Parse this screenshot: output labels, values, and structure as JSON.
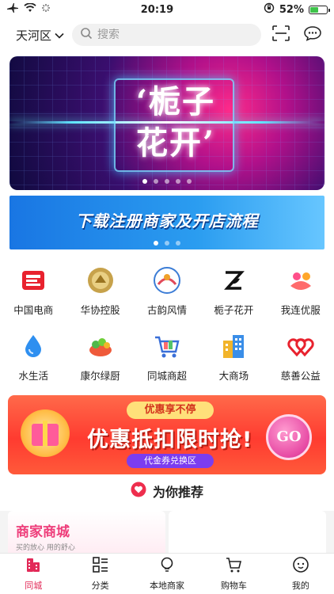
{
  "status_bar": {
    "time": "20:19",
    "battery": "52%",
    "battery_level": 0.52
  },
  "header": {
    "city": "天河区",
    "search_placeholder": "搜索"
  },
  "banner": {
    "title_line1": "‘栀子",
    "title_line2": "花开’",
    "dots": 5,
    "active_dot": 0
  },
  "banner2": {
    "text": "下载注册商家及开店流程",
    "dots": 3,
    "active_dot": 0
  },
  "shortcuts": [
    {
      "label": "中国电商",
      "icon": "china-ecommerce-icon"
    },
    {
      "label": "华协控股",
      "icon": "huaxie-holding-icon"
    },
    {
      "label": "古韵风情",
      "icon": "guyun-style-icon"
    },
    {
      "label": "栀子花开",
      "icon": "gardenia-icon"
    },
    {
      "label": "我连优服",
      "icon": "wolian-service-icon"
    },
    {
      "label": "水生活",
      "icon": "water-drop-icon"
    },
    {
      "label": "康尔绿厨",
      "icon": "green-kitchen-icon"
    },
    {
      "label": "同城商超",
      "icon": "shopping-cart-icon"
    },
    {
      "label": "大商场",
      "icon": "mall-building-icon"
    },
    {
      "label": "慈善公益",
      "icon": "charity-hearts-icon"
    }
  ],
  "promo": {
    "tag": "优惠享不停",
    "main": "优惠抵扣限时抢!",
    "sub": "代金券兑换区",
    "go": "GO"
  },
  "recommend": {
    "label": "为你推荐"
  },
  "cards": [
    {
      "title": "商家商城",
      "subtitle": "买的放心 用的舒心"
    }
  ],
  "tabbar": [
    {
      "label": "同城",
      "icon": "city-tab-icon",
      "active": true
    },
    {
      "label": "分类",
      "icon": "category-tab-icon",
      "active": false
    },
    {
      "label": "本地商家",
      "icon": "local-merchant-icon",
      "active": false
    },
    {
      "label": "购物车",
      "icon": "cart-tab-icon",
      "active": false
    },
    {
      "label": "我的",
      "icon": "profile-tab-icon",
      "active": false
    }
  ],
  "colors": {
    "accent": "#e22a58",
    "promo_red": "#ff3b30",
    "battery_green": "#3ec34a"
  }
}
